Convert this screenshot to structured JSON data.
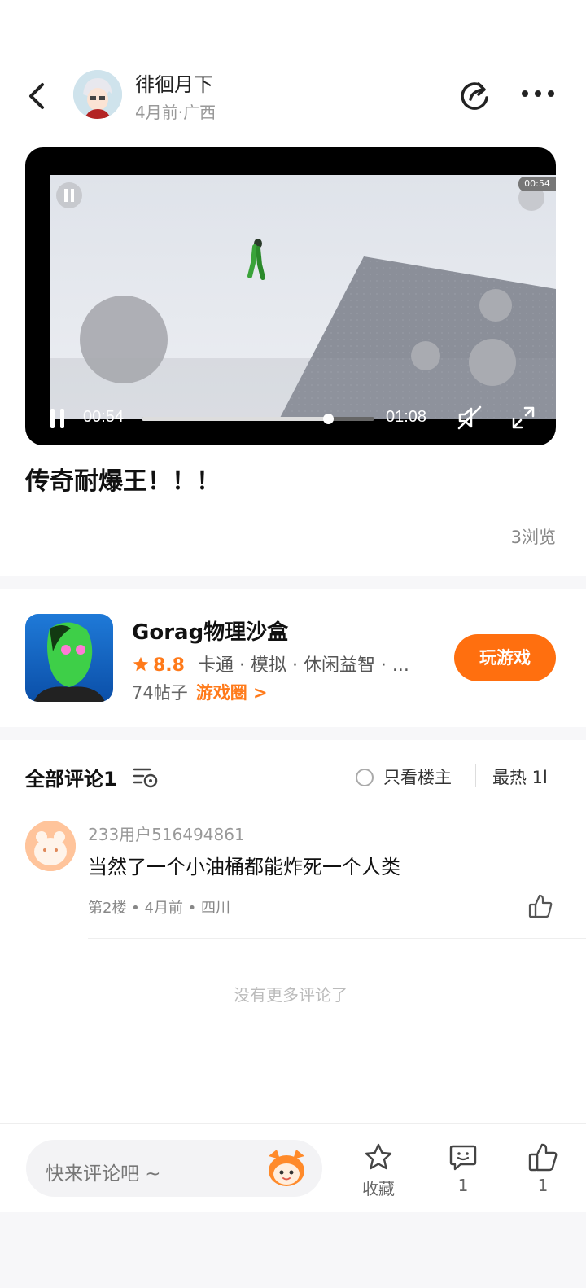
{
  "header": {
    "author_name": "徘徊月下",
    "author_meta": "4月前·广西"
  },
  "video": {
    "overlay_time": "00:54",
    "current_time": "00:54",
    "duration": "01:08",
    "progress": 0.8
  },
  "post": {
    "title": "传奇耐爆王！！！",
    "views": "3浏览"
  },
  "game": {
    "name": "Gorag物理沙盒",
    "rating": "8.8",
    "tags": "卡通 · 模拟 · 休闲益智 · ...",
    "posts": "74帖子",
    "circle_link": "游戏圈 >",
    "play_label": "玩游戏"
  },
  "comments": {
    "title": "全部评论1",
    "only_owner_label": "只看楼主",
    "sort_label": "最热 1l",
    "items": [
      {
        "user": "233用户516494861",
        "text": "当然了一个小油桶都能炸死一个人类",
        "meta": "第2楼 • 4月前 • 四川"
      }
    ],
    "no_more": "没有更多评论了"
  },
  "bottom_bar": {
    "input_placeholder": "快来评论吧 ~",
    "favorite_label": "收藏",
    "comment_count": "1",
    "like_count": "1"
  },
  "colors": {
    "accent": "#ff6f0f",
    "text_primary": "#111111",
    "text_secondary": "#999999"
  }
}
